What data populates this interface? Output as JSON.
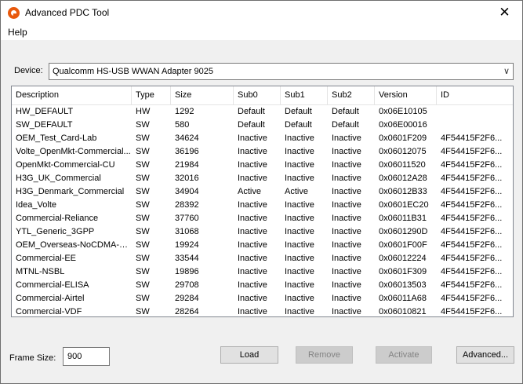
{
  "window": {
    "title": "Advanced PDC Tool",
    "close_glyph": "✕"
  },
  "menu": {
    "help": "Help"
  },
  "device": {
    "label": "Device:",
    "selected": "Qualcomm HS-USB WWAN Adapter 9025"
  },
  "table": {
    "columns": [
      "Description",
      "Type",
      "Size",
      "Sub0",
      "Sub1",
      "Sub2",
      "Version",
      "ID"
    ],
    "rows": [
      [
        "HW_DEFAULT",
        "HW",
        "1292",
        "Default",
        "Default",
        "Default",
        "0x06E10105",
        ""
      ],
      [
        "SW_DEFAULT",
        "SW",
        "580",
        "Default",
        "Default",
        "Default",
        "0x06E00016",
        ""
      ],
      [
        "OEM_Test_Card-Lab",
        "SW",
        "34624",
        "Inactive",
        "Inactive",
        "Inactive",
        "0x0601F209",
        "4F54415F2F6..."
      ],
      [
        "Volte_OpenMkt-Commercial...",
        "SW",
        "36196",
        "Inactive",
        "Inactive",
        "Inactive",
        "0x06012075",
        "4F54415F2F6..."
      ],
      [
        "OpenMkt-Commercial-CU",
        "SW",
        "21984",
        "Inactive",
        "Inactive",
        "Inactive",
        "0x06011520",
        "4F54415F2F6..."
      ],
      [
        "H3G_UK_Commercial",
        "SW",
        "32016",
        "Inactive",
        "Inactive",
        "Inactive",
        "0x06012A28",
        "4F54415F2F6..."
      ],
      [
        "H3G_Denmark_Commercial",
        "SW",
        "34904",
        "Active",
        "Active",
        "Inactive",
        "0x06012B33",
        "4F54415F2F6..."
      ],
      [
        "Idea_Volte",
        "SW",
        "28392",
        "Inactive",
        "Inactive",
        "Inactive",
        "0x0601EC20",
        "4F54415F2F6..."
      ],
      [
        "Commercial-Reliance",
        "SW",
        "37760",
        "Inactive",
        "Inactive",
        "Inactive",
        "0x06011B31",
        "4F54415F2F6..."
      ],
      [
        "YTL_Generic_3GPP",
        "SW",
        "31068",
        "Inactive",
        "Inactive",
        "Inactive",
        "0x0601290D",
        "4F54415F2F6..."
      ],
      [
        "OEM_Overseas-NoCDMA-C...",
        "SW",
        "19924",
        "Inactive",
        "Inactive",
        "Inactive",
        "0x0601F00F",
        "4F54415F2F6..."
      ],
      [
        "Commercial-EE",
        "SW",
        "33544",
        "Inactive",
        "Inactive",
        "Inactive",
        "0x06012224",
        "4F54415F2F6..."
      ],
      [
        "MTNL-NSBL",
        "SW",
        "19896",
        "Inactive",
        "Inactive",
        "Inactive",
        "0x0601F309",
        "4F54415F2F6..."
      ],
      [
        "Commercial-ELISA",
        "SW",
        "29708",
        "Inactive",
        "Inactive",
        "Inactive",
        "0x06013503",
        "4F54415F2F6..."
      ],
      [
        "Commercial-Airtel",
        "SW",
        "29284",
        "Inactive",
        "Inactive",
        "Inactive",
        "0x06011A68",
        "4F54415F2F6..."
      ],
      [
        "Commercial-VDF",
        "SW",
        "28264",
        "Inactive",
        "Inactive",
        "Inactive",
        "0x06010821",
        "4F54415F2F6..."
      ]
    ]
  },
  "frame": {
    "label": "Frame Size:",
    "value": "900"
  },
  "buttons": {
    "load": "Load",
    "remove": "Remove",
    "activate": "Activate",
    "advanced": "Advanced..."
  }
}
